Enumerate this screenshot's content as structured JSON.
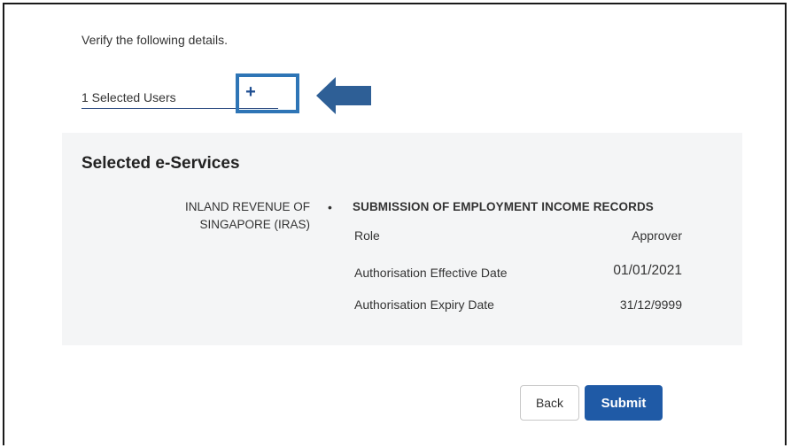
{
  "instruction": "Verify the following details.",
  "selected_users": {
    "label": "1 Selected Users",
    "add_icon": "plus-icon",
    "add_glyph": "+"
  },
  "annotation": {
    "arrow_icon": "left-arrow-icon",
    "highlight_color": "#2e75b6",
    "arrow_color": "#2e5f96"
  },
  "eservices": {
    "title": "Selected e-Services",
    "agency_line1": "INLAND REVENUE OF",
    "agency_line2": "SINGAPORE (IRAS)",
    "bullet": "•",
    "service_name": "SUBMISSION OF EMPLOYMENT INCOME RECORDS",
    "rows": [
      {
        "label": "Role",
        "value": "Approver"
      },
      {
        "label": "Authorisation Effective Date",
        "value": "01/01/2021"
      },
      {
        "label": "Authorisation Expiry Date",
        "value": "31/12/9999"
      }
    ]
  },
  "actions": {
    "back_label": "Back",
    "submit_label": "Submit"
  },
  "colors": {
    "primary": "#1f5aa6",
    "panel_bg": "#f4f5f6"
  }
}
